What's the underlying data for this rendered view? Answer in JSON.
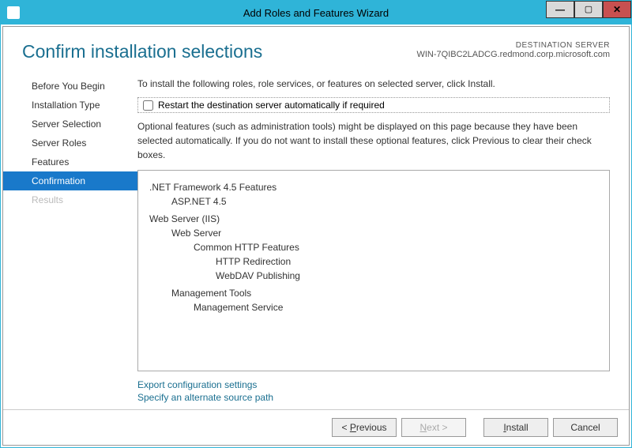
{
  "window": {
    "title": "Add Roles and Features Wizard"
  },
  "header": {
    "title": "Confirm installation selections",
    "destLabel": "DESTINATION SERVER",
    "destServer": "WIN-7QIBC2LADCG.redmond.corp.microsoft.com"
  },
  "nav": {
    "items": [
      {
        "label": "Before You Begin",
        "state": "normal"
      },
      {
        "label": "Installation Type",
        "state": "normal"
      },
      {
        "label": "Server Selection",
        "state": "normal"
      },
      {
        "label": "Server Roles",
        "state": "normal"
      },
      {
        "label": "Features",
        "state": "normal"
      },
      {
        "label": "Confirmation",
        "state": "active"
      },
      {
        "label": "Results",
        "state": "disabled"
      }
    ]
  },
  "main": {
    "instruction": "To install the following roles, role services, or features on selected server, click Install.",
    "restartCheckboxLabel": "Restart the destination server automatically if required",
    "restartChecked": false,
    "optionalText": "Optional features (such as administration tools) might be displayed on this page because they have been selected automatically. If you do not want to install these optional features, click Previous to clear their check boxes.",
    "features": [
      {
        "level": 0,
        "label": ".NET Framework 4.5 Features"
      },
      {
        "level": 1,
        "label": "ASP.NET 4.5"
      },
      {
        "level": 0,
        "label": "Web Server (IIS)",
        "group": true
      },
      {
        "level": 1,
        "label": "Web Server"
      },
      {
        "level": 2,
        "label": "Common HTTP Features"
      },
      {
        "level": 3,
        "label": "HTTP Redirection"
      },
      {
        "level": 3,
        "label": "WebDAV Publishing"
      },
      {
        "level": 1,
        "label": "Management Tools",
        "group": true
      },
      {
        "level": 2,
        "label": "Management Service"
      }
    ],
    "links": {
      "export": "Export configuration settings",
      "altSource": "Specify an alternate source path"
    }
  },
  "footer": {
    "previous": "< Previous",
    "next": "Next >",
    "install": "Install",
    "cancel": "Cancel",
    "nextEnabled": false
  }
}
